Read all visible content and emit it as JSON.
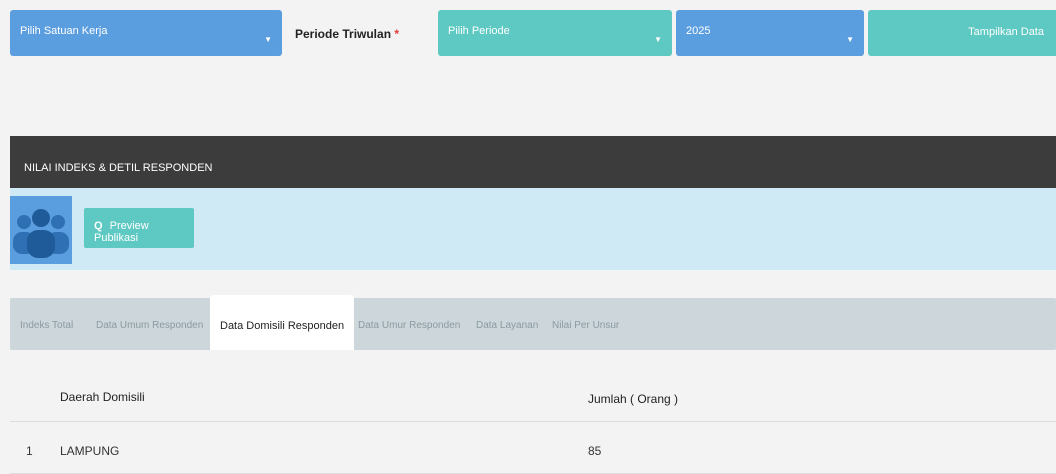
{
  "filters": {
    "unit_placeholder": "Pilih Satuan Kerja",
    "period_label": "Periode Triwulan",
    "required_mark": "*",
    "period_placeholder": "Pilih Periode",
    "year_value": "2025",
    "show_button": "Tampilkan Data"
  },
  "section": {
    "title": "NILAI INDEKS & DETIL RESPONDEN",
    "preview_button": "Preview Publikasi"
  },
  "tabs": [
    {
      "label": "Indeks Total"
    },
    {
      "label": "Data Umum Responden"
    },
    {
      "label": "Data Domisili Responden"
    },
    {
      "label": "Data Umur Responden"
    },
    {
      "label": "Data Layanan"
    },
    {
      "label": "Nilai Per Unsur"
    }
  ],
  "table": {
    "columns": [
      "Daerah Domisili",
      "Jumlah ( Orang )"
    ],
    "rows": [
      {
        "no": "1",
        "area": "LAMPUNG",
        "count": "85"
      }
    ]
  },
  "colors": {
    "blue": "#5b9ee0",
    "teal": "#5ec8c2",
    "dark": "#3c3c3c"
  }
}
